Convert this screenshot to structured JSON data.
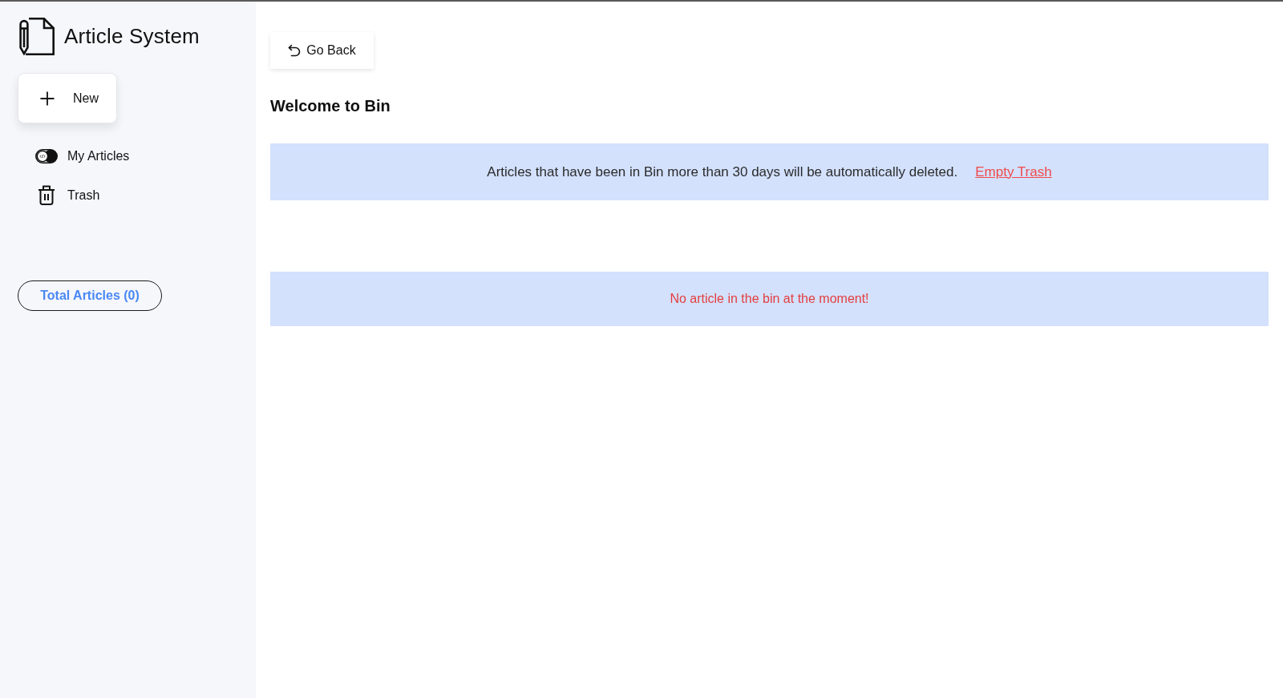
{
  "app": {
    "title": "Article System"
  },
  "sidebar": {
    "new_button": {
      "label": "New"
    },
    "items": [
      {
        "kind": "articles",
        "label": "My Articles"
      },
      {
        "kind": "trash",
        "label": "Trash"
      }
    ],
    "total": "Total Articles (0)"
  },
  "main": {
    "back_button": {
      "label": "Go Back"
    },
    "heading": "Welcome to Bin",
    "notice": {
      "text": "Articles that have been in Bin more than 30 days will be automatically deleted.",
      "link": "Empty Trash"
    },
    "empty_message": "No article in the bin at the moment!"
  }
}
